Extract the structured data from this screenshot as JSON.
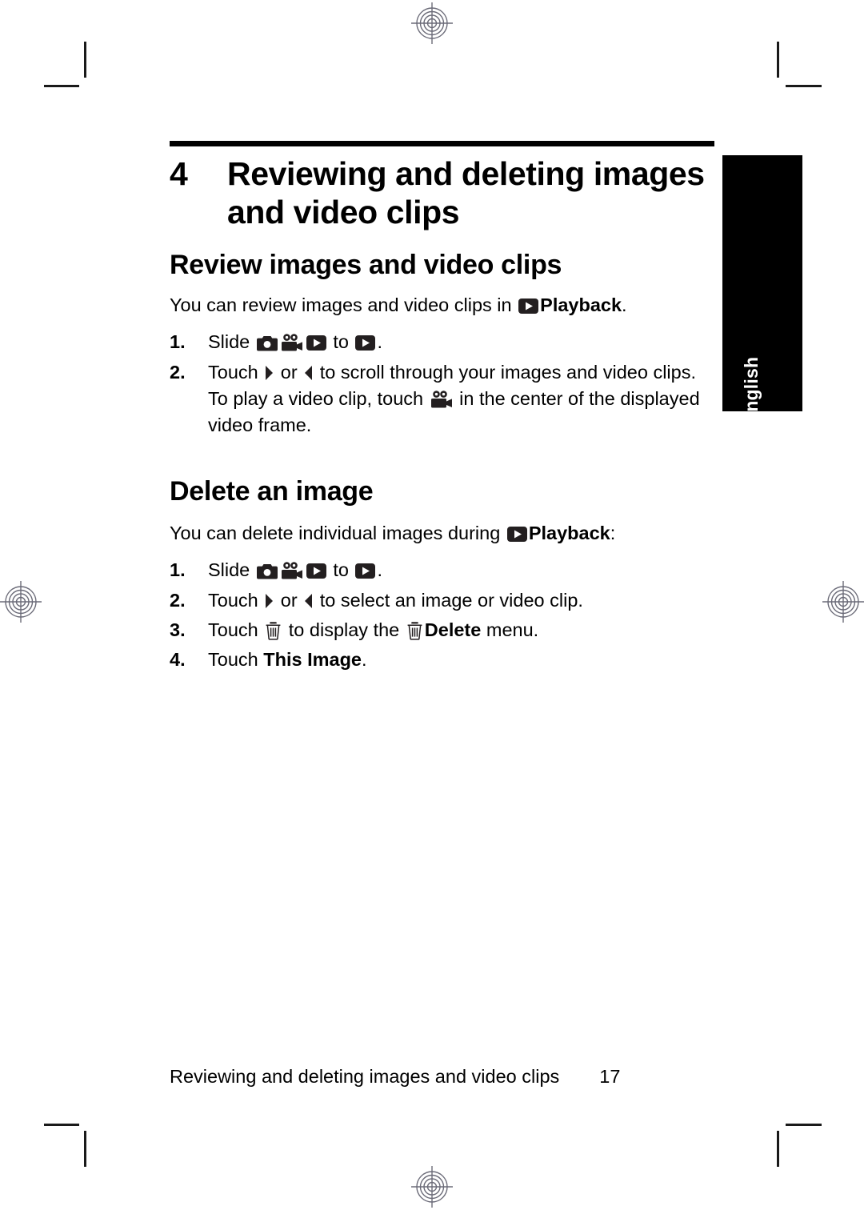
{
  "document": {
    "language_tab": "English",
    "chapter_number": "4",
    "chapter_title": "Reviewing and deleting images and video clips"
  },
  "sections": [
    {
      "heading": "Review images and video clips",
      "intro_before": "You can review images and video clips in ",
      "intro_icon": "playback-icon",
      "intro_bold": "Playback",
      "intro_after": ".",
      "steps": [
        {
          "number": "1.",
          "text_1": "Slide ",
          "icon_1": "still-camera-icon",
          "icon_2": "video-camera-icon",
          "icon_3": "playback-icon",
          "text_2": " to ",
          "icon_4": "playback-icon",
          "text_3": "."
        },
        {
          "number": "2.",
          "text_1": "Touch ",
          "icon_1": "arrow-right-icon",
          "text_2": " or ",
          "icon_2": "arrow-left-icon",
          "text_3": " to scroll through your images and video clips. To play a video clip, touch ",
          "icon_3": "video-camera-icon",
          "text_4": " in the center of the displayed video frame."
        }
      ]
    },
    {
      "heading": "Delete an image",
      "intro_before": "You can delete individual images during ",
      "intro_icon": "playback-icon",
      "intro_bold": "Playback",
      "intro_after": ":",
      "steps": [
        {
          "number": "1.",
          "text_1": "Slide ",
          "icon_1": "still-camera-icon",
          "icon_2": "video-camera-icon",
          "icon_3": "playback-icon",
          "text_2": " to ",
          "icon_4": "playback-icon",
          "text_3": "."
        },
        {
          "number": "2.",
          "text_1": "Touch ",
          "icon_1": "arrow-right-icon",
          "text_2": " or ",
          "icon_2": "arrow-left-icon",
          "text_3": " to select an image or video clip."
        },
        {
          "number": "3.",
          "text_1": "Touch ",
          "icon_1": "trash-icon",
          "text_2": " to display the ",
          "icon_2": "trash-icon",
          "bold_1": "Delete",
          "text_3": " menu."
        },
        {
          "number": "4.",
          "text_1": "Touch ",
          "bold_1": "This Image",
          "text_2": "."
        }
      ]
    }
  ],
  "footer": {
    "title": "Reviewing and deleting images and video clips",
    "page_number": "17"
  },
  "colors": {
    "ink": "#000000",
    "paper": "#ffffff",
    "registration": "#6b6b78",
    "crop_mark": "#1a1a1a"
  }
}
